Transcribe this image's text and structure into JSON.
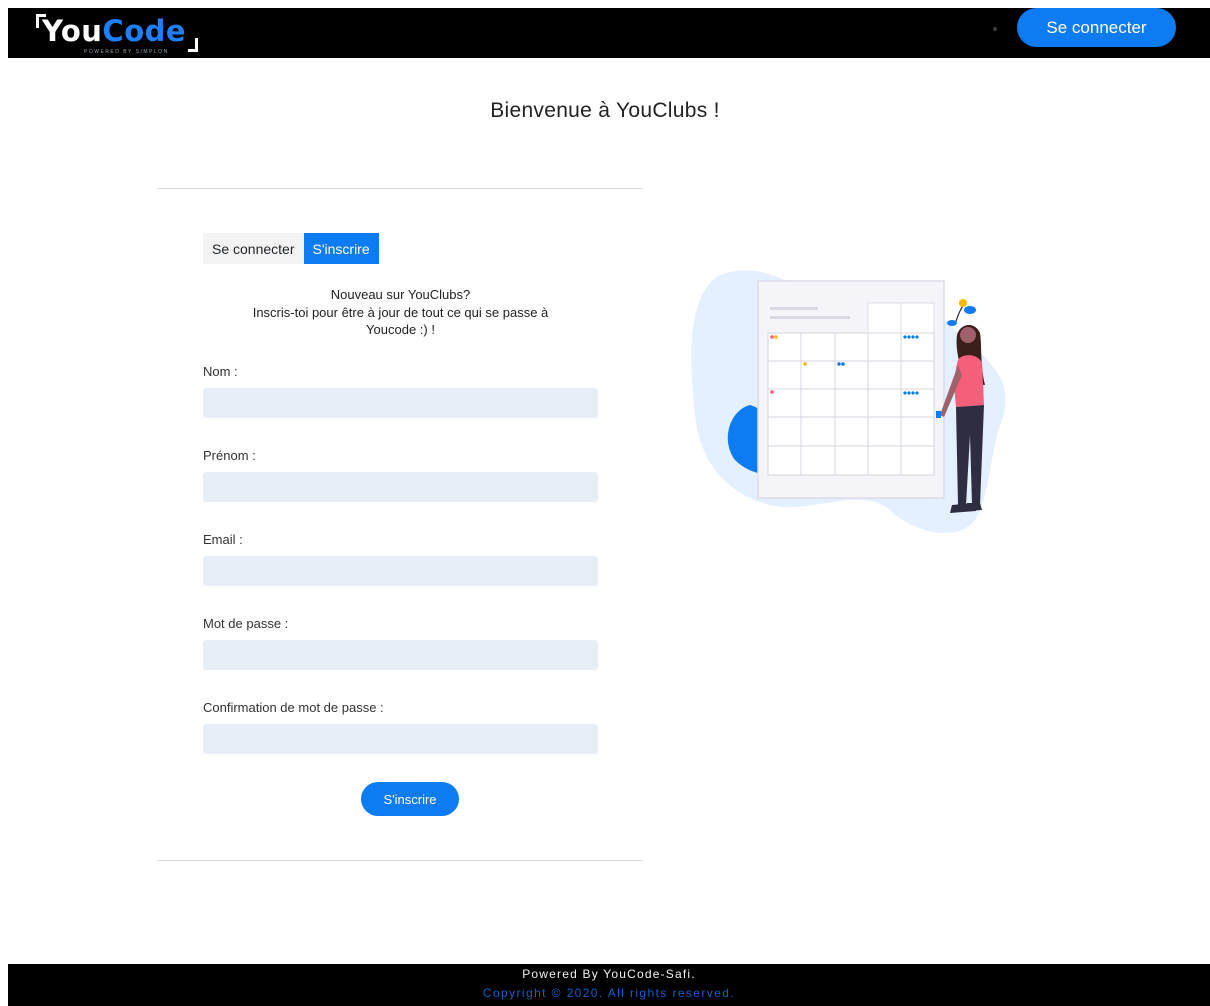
{
  "header": {
    "logo": {
      "you": "You",
      "code": "Code",
      "tagline": "POWERED BY SIMPLON"
    },
    "login_button": "Se connecter"
  },
  "page_title": "Bienvenue à YouClubs !",
  "tabs": [
    {
      "label": "Se connecter",
      "active": false
    },
    {
      "label": "S'inscrire",
      "active": true
    }
  ],
  "intro": {
    "line1": "Nouveau sur YouClubs?",
    "line2": "Inscris-toi pour être à jour de tout ce qui se passe à",
    "line3": "Youcode :) !"
  },
  "form": {
    "fields": [
      {
        "label": "Nom :",
        "value": ""
      },
      {
        "label": "Prénom :",
        "value": ""
      },
      {
        "label": "Email :",
        "value": ""
      },
      {
        "label": "Mot de passe :",
        "value": ""
      },
      {
        "label": "Confirmation de mot de passe :",
        "value": ""
      }
    ],
    "submit_label": "S'inscrire"
  },
  "illustration": {
    "icon": "calendar-woman-illustration"
  },
  "footer": {
    "line1": "Powered By YouCode-Safi.",
    "line2": "Copyright © 2020. All rights reserved."
  },
  "colors": {
    "accent": "#0d7cf2",
    "header_bg": "#000000",
    "input_bg": "#e8eef6",
    "footer_link": "#1660c8"
  }
}
